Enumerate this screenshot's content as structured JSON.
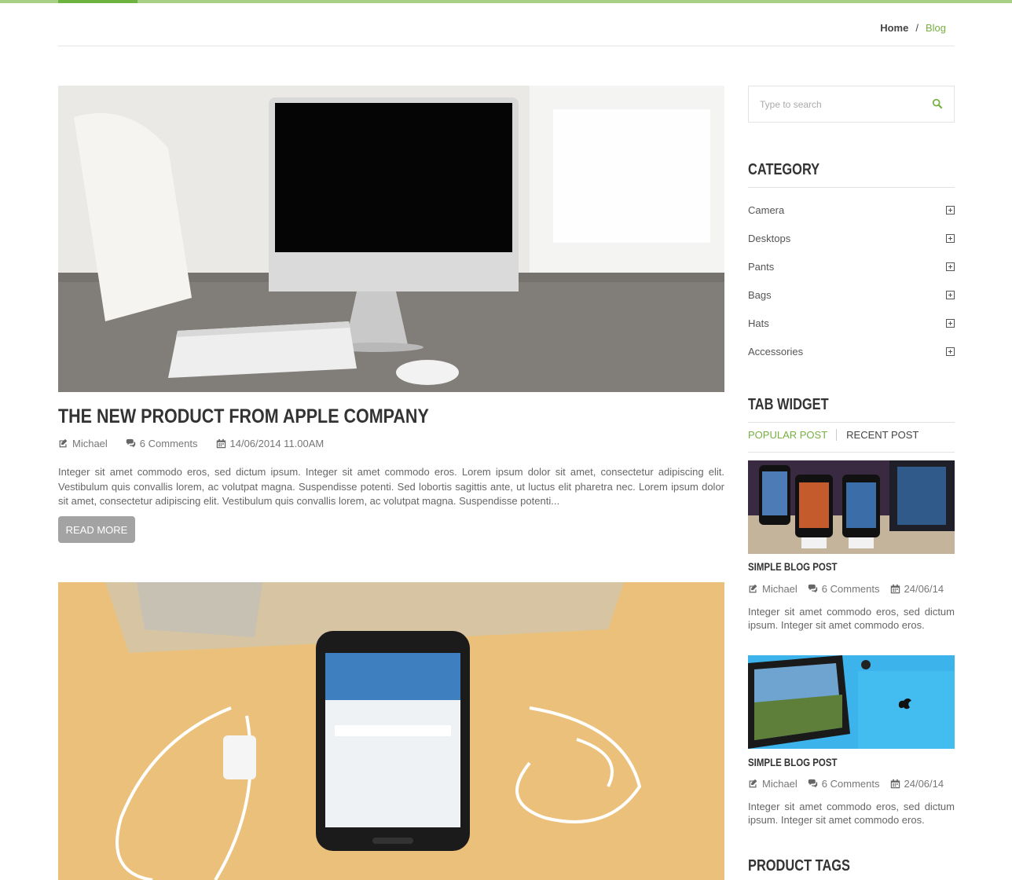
{
  "breadcrumb": {
    "home": "Home",
    "separator": "/",
    "current": "Blog"
  },
  "post1": {
    "title": "THE NEW PRODUCT FROM APPLE COMPANY",
    "author": "Michael",
    "comments": "6 Comments",
    "date": "14/06/2014 11.00AM",
    "excerpt": "Integer sit amet commodo eros, sed dictum ipsum. Integer sit amet commodo eros. Lorem ipsum dolor sit amet, consectetur adipiscing elit. Vestibulum quis convallis lorem, ac volutpat magna. Suspendisse potenti. Sed lobortis sagittis ante, ut luctus elit pharetra nec. Lorem ipsum dolor sit amet, consectetur adipiscing elit. Vestibulum quis convallis lorem, ac volutpat magna. Suspendisse potenti...",
    "read_more": "Read More"
  },
  "sidebar": {
    "search_placeholder": "Type to search",
    "category_title": "CATEGORY",
    "categories": [
      "Camera",
      "Desktops",
      "Pants",
      "Bags",
      "Hats",
      "Accessories"
    ],
    "tab_widget_title": "TAB WIDGET",
    "tabs": [
      "POPULAR POST",
      "RECENT POST"
    ],
    "posts": [
      {
        "title": "SIMPLE BLOG POST",
        "author": "Michael",
        "comments": "6 Comments",
        "date": "24/06/14",
        "excerpt": "Integer sit amet commodo eros, sed dictum ipsum. Integer sit amet commodo eros."
      },
      {
        "title": "SIMPLE BLOG POST",
        "author": "Michael",
        "comments": "6 Comments",
        "date": "24/06/14",
        "excerpt": "Integer sit amet commodo eros, sed dictum ipsum. Integer sit amet commodo eros."
      }
    ],
    "product_tags_title": "PRODUCT TAGS"
  },
  "colors": {
    "accent": "#76b041",
    "topbar": "#a8cf86"
  }
}
